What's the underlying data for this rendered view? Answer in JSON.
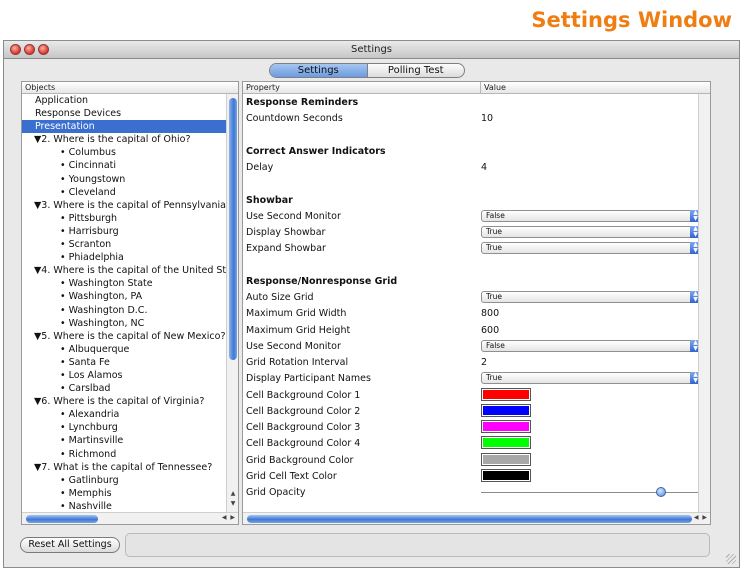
{
  "heading": "Settings Window",
  "window": {
    "title": "Settings",
    "tabs": [
      {
        "label": "Settings",
        "active": true
      },
      {
        "label": "Polling Test",
        "active": false
      }
    ]
  },
  "objects_panel": {
    "header": "Objects",
    "items": [
      {
        "label": "Application",
        "level": 0
      },
      {
        "label": "Response Devices",
        "level": 0
      },
      {
        "label": "Presentation",
        "level": 0,
        "selected": true
      },
      {
        "label": "▼2. Where is the capital of Ohio?",
        "level": 1
      },
      {
        "label": "• Columbus",
        "level": 2
      },
      {
        "label": "• Cincinnati",
        "level": 2
      },
      {
        "label": "• Youngstown",
        "level": 2
      },
      {
        "label": "• Cleveland",
        "level": 2
      },
      {
        "label": "▼3. Where is  the capital of Pennsylvania?",
        "level": 1
      },
      {
        "label": "• Pittsburgh",
        "level": 2
      },
      {
        "label": "• Harrisburg",
        "level": 2
      },
      {
        "label": "• Scranton",
        "level": 2
      },
      {
        "label": "• Phiadelphia",
        "level": 2
      },
      {
        "label": "▼4. Where is the capital of the United State",
        "level": 1
      },
      {
        "label": "• Washington State",
        "level": 2
      },
      {
        "label": "• Washington, PA",
        "level": 2
      },
      {
        "label": "• Washington D.C.",
        "level": 2
      },
      {
        "label": "• Washington, NC",
        "level": 2
      },
      {
        "label": "▼5. Where is the capital of New Mexico?",
        "level": 1
      },
      {
        "label": "• Albuquerque",
        "level": 2
      },
      {
        "label": "• Santa Fe",
        "level": 2
      },
      {
        "label": "• Los Alamos",
        "level": 2
      },
      {
        "label": "• Carslbad",
        "level": 2
      },
      {
        "label": "▼6. Where is the capital of Virginia?",
        "level": 1
      },
      {
        "label": "• Alexandria",
        "level": 2
      },
      {
        "label": "• Lynchburg",
        "level": 2
      },
      {
        "label": "• Martinsville",
        "level": 2
      },
      {
        "label": "• Richmond",
        "level": 2
      },
      {
        "label": "▼7. What is the capital of Tennessee?",
        "level": 1
      },
      {
        "label": "• Gatlinburg",
        "level": 2
      },
      {
        "label": "• Memphis",
        "level": 2
      },
      {
        "label": "• Nashville",
        "level": 2
      }
    ]
  },
  "property_grid": {
    "col_property": "Property",
    "col_value": "Value",
    "rows": [
      {
        "kind": "header",
        "name": "Response Reminders"
      },
      {
        "kind": "text",
        "name": "Countdown Seconds",
        "value": "10"
      },
      {
        "kind": "blank"
      },
      {
        "kind": "header",
        "name": "Correct Answer Indicators"
      },
      {
        "kind": "text",
        "name": "Delay",
        "value": "4"
      },
      {
        "kind": "blank"
      },
      {
        "kind": "header",
        "name": "Showbar"
      },
      {
        "kind": "select",
        "name": "Use Second Monitor",
        "value": "False"
      },
      {
        "kind": "select",
        "name": "Display Showbar",
        "value": "True"
      },
      {
        "kind": "select",
        "name": "Expand Showbar",
        "value": "True"
      },
      {
        "kind": "blank"
      },
      {
        "kind": "header",
        "name": "Response/Nonresponse Grid"
      },
      {
        "kind": "select",
        "name": "Auto Size Grid",
        "value": "True"
      },
      {
        "kind": "text",
        "name": "Maximum Grid Width",
        "value": "800"
      },
      {
        "kind": "text",
        "name": "Maximum Grid Height",
        "value": "600"
      },
      {
        "kind": "select",
        "name": "Use Second Monitor",
        "value": "False"
      },
      {
        "kind": "text",
        "name": "Grid Rotation Interval",
        "value": "2"
      },
      {
        "kind": "select",
        "name": "Display Participant Names",
        "value": "True"
      },
      {
        "kind": "color",
        "name": "Cell Background Color 1",
        "color": "#ff0000"
      },
      {
        "kind": "color",
        "name": "Cell Background Color 2",
        "color": "#0000ff"
      },
      {
        "kind": "color",
        "name": "Cell Background Color 3",
        "color": "#ff00ff"
      },
      {
        "kind": "color",
        "name": "Cell Background Color 4",
        "color": "#00ff00"
      },
      {
        "kind": "color",
        "name": "Grid Background Color",
        "color": "#a8a8a8"
      },
      {
        "kind": "color",
        "name": "Grid Cell Text Color",
        "color": "#000000"
      },
      {
        "kind": "slider",
        "name": "Grid Opacity",
        "level": 0.82
      }
    ]
  },
  "footer": {
    "reset_label": "Reset All Settings"
  }
}
